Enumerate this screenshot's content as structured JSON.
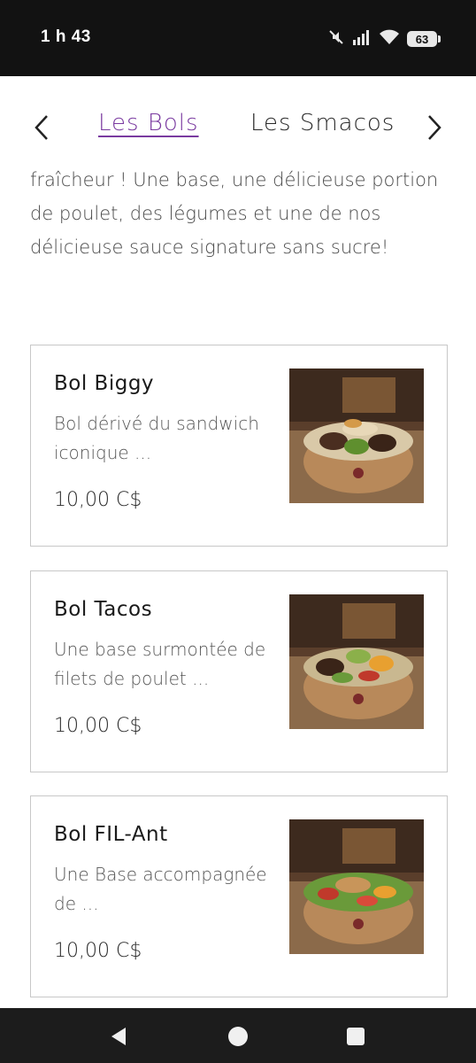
{
  "status": {
    "time": "1 h 43",
    "battery": "63"
  },
  "tabs": {
    "active": "Les Bols",
    "next": "Les Smacos"
  },
  "description": "fraîcheur ! Une base, une délicieuse portion de poulet, des légumes et une de nos délicieuse sauce signature sans sucre!",
  "menu": [
    {
      "title": "Bol Biggy",
      "desc": "Bol dérivé du sandwich iconique ...",
      "price": "10,00 C$"
    },
    {
      "title": "Bol Tacos",
      "desc": "Une base surmontée de filets de poulet ...",
      "price": "10,00 C$"
    },
    {
      "title": "Bol FIL-Ant",
      "desc": "Une Base accompagnée de ...",
      "price": "10,00 C$"
    }
  ],
  "icons": {
    "mute": "mute-icon",
    "signal": "signal-icon",
    "wifi": "wifi-icon",
    "back": "back-icon",
    "home": "home-icon",
    "recents": "recents-icon"
  }
}
